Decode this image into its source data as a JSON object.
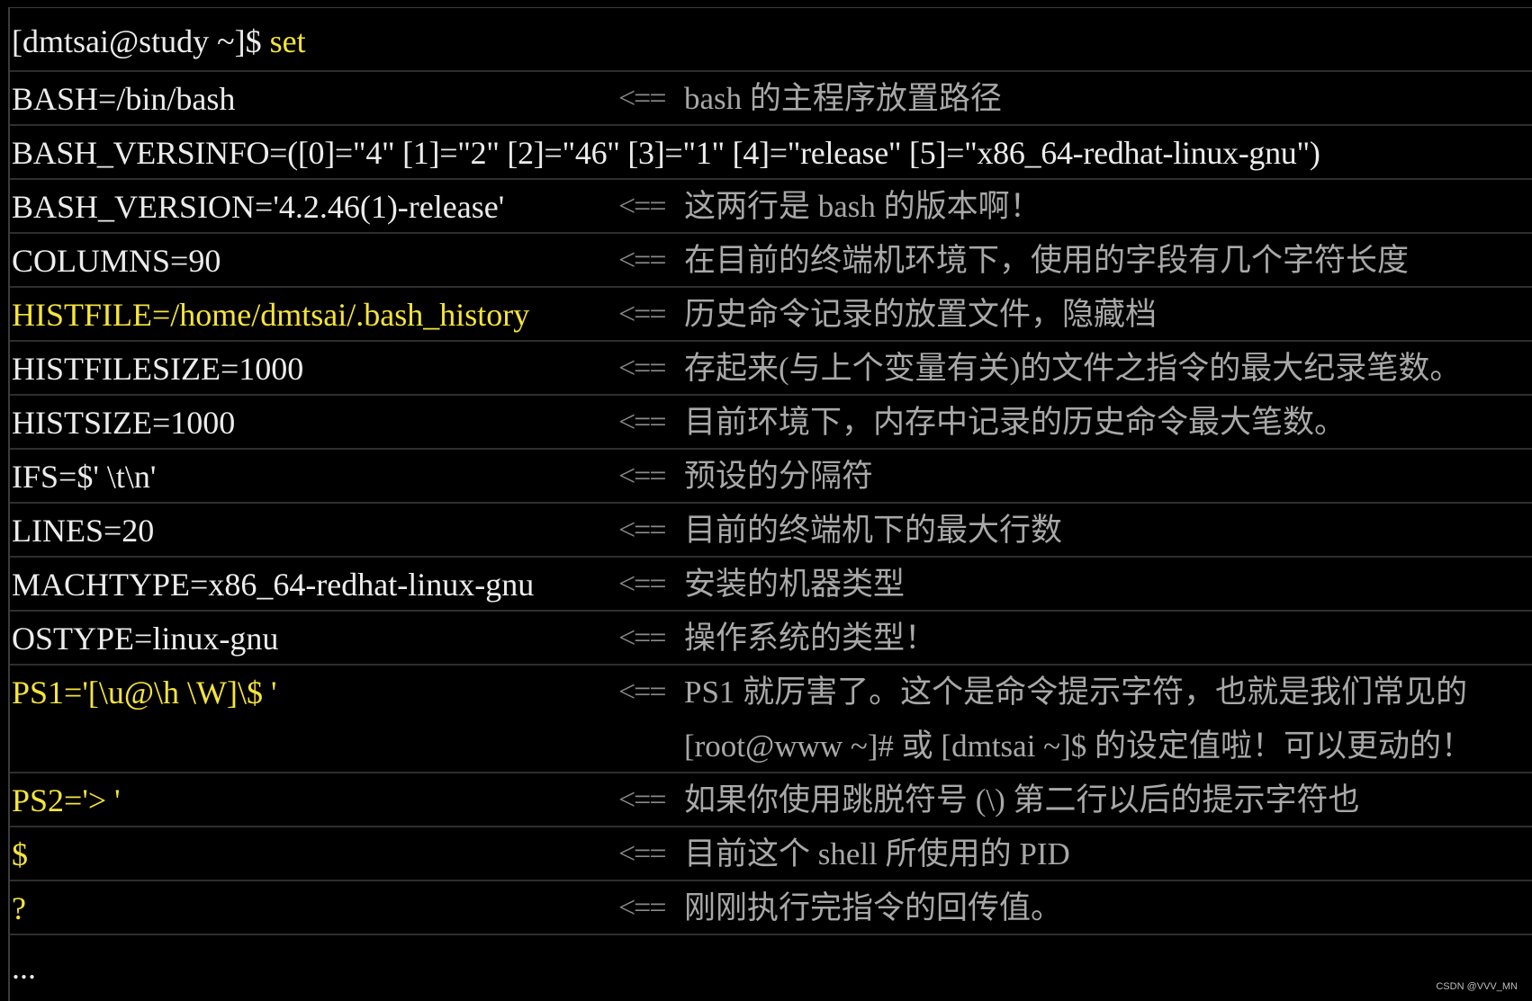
{
  "prompt": {
    "text": "[dmtsai@study ~]$ ",
    "command": "set"
  },
  "rows": [
    {
      "var": "BASH=/bin/bash",
      "arrow": "<==",
      "desc": "bash 的主程序放置路径",
      "highlight": false
    },
    {
      "var": "BASH_VERSINFO=([0]=\"4\" [1]=\"2\" [2]=\"46\" [3]=\"1\" [4]=\"release\" [5]=\"x86_64-redhat-linux-gnu\")",
      "arrow": "",
      "desc": "",
      "highlight": false
    },
    {
      "var": "BASH_VERSION='4.2.46(1)-release'",
      "arrow": "<==",
      "desc": "这两行是 bash 的版本啊！",
      "highlight": false
    },
    {
      "var": "COLUMNS=90",
      "arrow": "<==",
      "desc": "在目前的终端机环境下，使用的字段有几个字符长度",
      "highlight": false
    },
    {
      "var": "HISTFILE=/home/dmtsai/.bash_history",
      "arrow": "<==",
      "desc": "历史命令记录的放置文件，隐藏档",
      "highlight": true
    },
    {
      "var": "HISTFILESIZE=1000",
      "arrow": "<==",
      "desc": "存起来(与上个变量有关)的文件之指令的最大纪录笔数。",
      "highlight": false
    },
    {
      "var": "HISTSIZE=1000",
      "arrow": "<==",
      "desc": "目前环境下，内存中记录的历史命令最大笔数。",
      "highlight": false
    },
    {
      "var": "IFS=$' \\t\\n'",
      "arrow": "<==",
      "desc": "预设的分隔符",
      "highlight": false
    },
    {
      "var": "LINES=20",
      "arrow": "<==",
      "desc": "目前的终端机下的最大行数",
      "highlight": false
    },
    {
      "var": "MACHTYPE=x86_64-redhat-linux-gnu",
      "arrow": "<==",
      "desc": "安装的机器类型",
      "highlight": false
    },
    {
      "var": "OSTYPE=linux-gnu",
      "arrow": "<==",
      "desc": "操作系统的类型！",
      "highlight": false
    },
    {
      "var": "PS1='[\\u@\\h \\W]\\$ '",
      "arrow": "<==",
      "desc": "PS1 就厉害了。这个是命令提示字符，也就是我们常见的",
      "desc2": "[root@www ~]# 或 [dmtsai ~]$ 的设定值啦！可以更动的！",
      "highlight": true
    },
    {
      "var": "PS2='> '",
      "arrow": "<==",
      "desc": "如果你使用跳脱符号 (\\) 第二行以后的提示字符也",
      "highlight": true
    },
    {
      "var": "$",
      "arrow": "<==",
      "desc": "目前这个 shell 所使用的 PID",
      "highlight": true
    },
    {
      "var": "?",
      "arrow": "<==",
      "desc": "刚刚执行完指令的回传值。",
      "highlight": true
    }
  ],
  "ellipsis": "...",
  "watermark": "CSDN @VVV_MN"
}
